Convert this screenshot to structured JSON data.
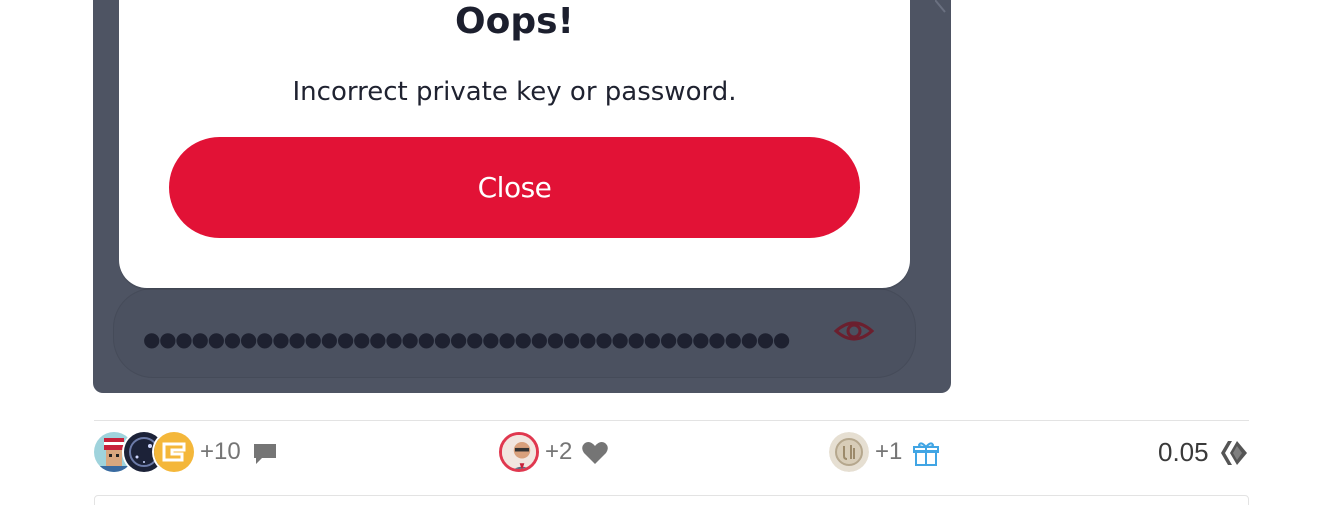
{
  "modal": {
    "title": "Oops!",
    "message": "Incorrect private key or password.",
    "close_label": "Close"
  },
  "password_field": {
    "masked_value": "●●●●●●●●●●●●●●●●●●●●●●●●●●●●●●●●●●●●●●●●"
  },
  "icons": {
    "show_password": "eye-icon",
    "comments": "comment-icon",
    "votes": "heart-icon",
    "tips": "gift-icon",
    "currency": "hive-logo-icon"
  },
  "footer": {
    "comments_extra": "+10",
    "votes_extra": "+2",
    "tips_extra": "+1",
    "payout": "0.05"
  },
  "colors": {
    "accent_red": "#e21236",
    "panel_bg": "#4e5463",
    "gift_blue": "#41a5e4"
  }
}
